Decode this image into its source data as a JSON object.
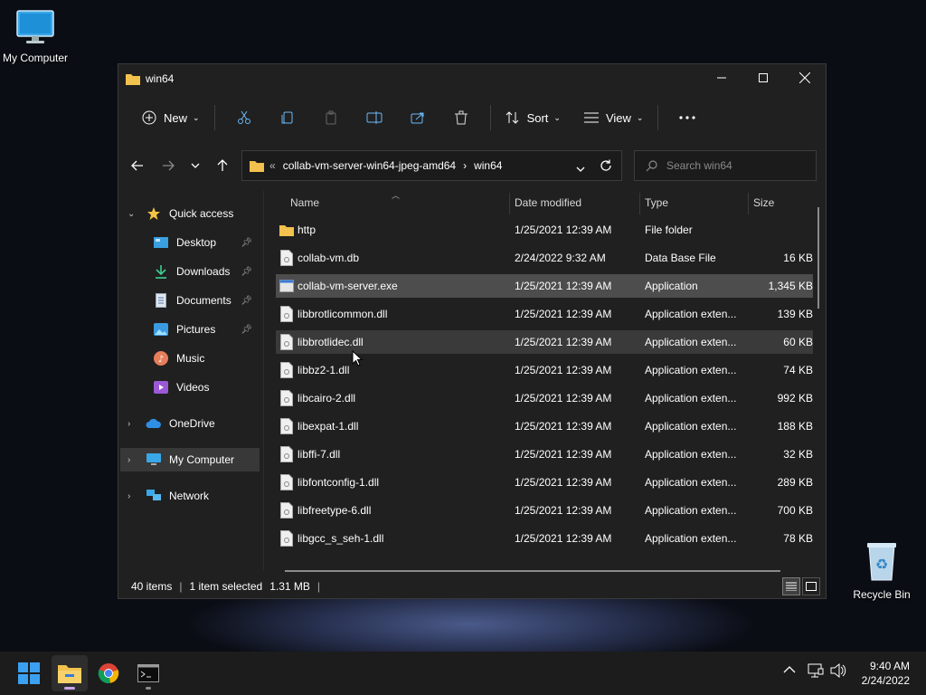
{
  "desktop": {
    "icons": [
      {
        "label": "My Computer"
      },
      {
        "label": "Recycle Bin"
      }
    ]
  },
  "window": {
    "title": "win64",
    "toolbar": {
      "new_label": "New",
      "sort_label": "Sort",
      "view_label": "View"
    },
    "address": {
      "overflow": "«",
      "crumbs": [
        "collab-vm-server-win64-jpeg-amd64",
        "win64"
      ],
      "separator": "›"
    },
    "search": {
      "placeholder": "Search win64"
    },
    "sidebar": {
      "items": [
        {
          "label": "Quick access"
        },
        {
          "label": "Desktop"
        },
        {
          "label": "Downloads"
        },
        {
          "label": "Documents"
        },
        {
          "label": "Pictures"
        },
        {
          "label": "Music"
        },
        {
          "label": "Videos"
        },
        {
          "label": "OneDrive"
        },
        {
          "label": "My Computer"
        },
        {
          "label": "Network"
        }
      ]
    },
    "columns": {
      "name": "Name",
      "date": "Date modified",
      "type": "Type",
      "size": "Size"
    },
    "files": [
      {
        "name": "http",
        "date": "1/25/2021 12:39 AM",
        "type": "File folder",
        "size": ""
      },
      {
        "name": "collab-vm.db",
        "date": "2/24/2022 9:32 AM",
        "type": "Data Base File",
        "size": "16 KB"
      },
      {
        "name": "collab-vm-server.exe",
        "date": "1/25/2021 12:39 AM",
        "type": "Application",
        "size": "1,345 KB"
      },
      {
        "name": "libbrotlicommon.dll",
        "date": "1/25/2021 12:39 AM",
        "type": "Application exten...",
        "size": "139 KB"
      },
      {
        "name": "libbrotlidec.dll",
        "date": "1/25/2021 12:39 AM",
        "type": "Application exten...",
        "size": "60 KB"
      },
      {
        "name": "libbz2-1.dll",
        "date": "1/25/2021 12:39 AM",
        "type": "Application exten...",
        "size": "74 KB"
      },
      {
        "name": "libcairo-2.dll",
        "date": "1/25/2021 12:39 AM",
        "type": "Application exten...",
        "size": "992 KB"
      },
      {
        "name": "libexpat-1.dll",
        "date": "1/25/2021 12:39 AM",
        "type": "Application exten...",
        "size": "188 KB"
      },
      {
        "name": "libffi-7.dll",
        "date": "1/25/2021 12:39 AM",
        "type": "Application exten...",
        "size": "32 KB"
      },
      {
        "name": "libfontconfig-1.dll",
        "date": "1/25/2021 12:39 AM",
        "type": "Application exten...",
        "size": "289 KB"
      },
      {
        "name": "libfreetype-6.dll",
        "date": "1/25/2021 12:39 AM",
        "type": "Application exten...",
        "size": "700 KB"
      },
      {
        "name": "libgcc_s_seh-1.dll",
        "date": "1/25/2021 12:39 AM",
        "type": "Application exten...",
        "size": "78 KB"
      }
    ],
    "status": {
      "items": "40 items",
      "selected": "1 item selected",
      "size": "1.31 MB",
      "sep": "|"
    }
  },
  "taskbar": {
    "time": "9:40 AM",
    "date": "2/24/2022"
  },
  "colors": {
    "folder": "#f2c14e",
    "accent": "#0a84ff",
    "selected_row": "#4d4d4d"
  }
}
